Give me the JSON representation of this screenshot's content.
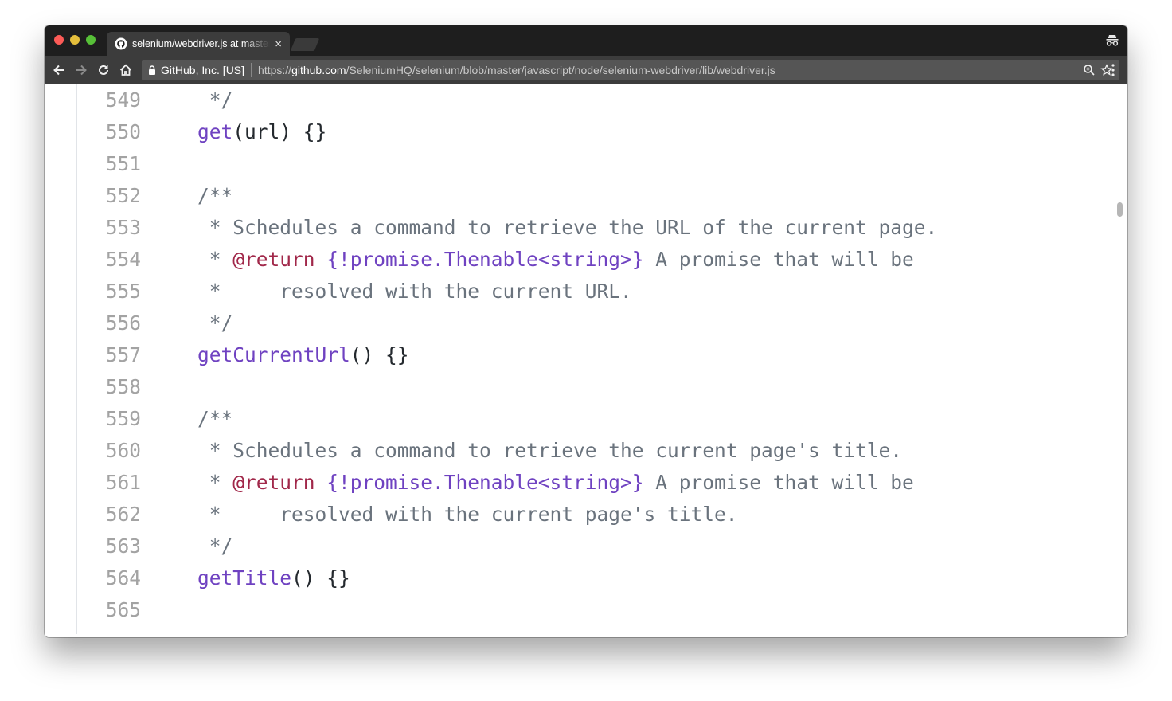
{
  "browser": {
    "tab": {
      "title": "selenium/webdriver.js at master · SeleniumHQ/selenium",
      "close_glyph": "×",
      "favicon": "github-icon"
    },
    "address_bar": {
      "identity": "GitHub, Inc. [US]",
      "url_scheme": "https://",
      "url_host": "github.com",
      "url_path": "/SeleniumHQ/selenium/blob/master/javascript/node/selenium-webdriver/lib/webdriver.js"
    },
    "icons": [
      "back-icon",
      "forward-icon",
      "reload-icon",
      "home-icon",
      "lock-icon",
      "zoom-icon",
      "star-icon",
      "menu-icon",
      "incognito-icon"
    ]
  },
  "colors": {
    "comment": "#6a737d",
    "doc_tag": "#a1284a",
    "type": "#6f42c1",
    "function": "#6f42c1",
    "line_number": "#a3a3a3",
    "plain": "#24292e"
  },
  "code_lines": [
    {
      "num": "549",
      "parts": [
        {
          "t": " */",
          "k": "cmt"
        }
      ]
    },
    {
      "num": "550",
      "parts": [
        {
          "t": "get",
          "k": "fn"
        },
        {
          "t": "(url) {}",
          "k": ""
        }
      ]
    },
    {
      "num": "551",
      "parts": []
    },
    {
      "num": "552",
      "parts": [
        {
          "t": "/**",
          "k": "cmt"
        }
      ]
    },
    {
      "num": "553",
      "parts": [
        {
          "t": " * Schedules a command to retrieve the URL of the current page.",
          "k": "cmt"
        }
      ]
    },
    {
      "num": "554",
      "parts": [
        {
          "t": " * ",
          "k": "cmt"
        },
        {
          "t": "@return",
          "k": "tag"
        },
        {
          "t": " {!promise.Thenable<string>}",
          "k": "typ"
        },
        {
          "t": " A promise that will be",
          "k": "cmt"
        }
      ]
    },
    {
      "num": "555",
      "parts": [
        {
          "t": " *     resolved with the current URL.",
          "k": "cmt"
        }
      ]
    },
    {
      "num": "556",
      "parts": [
        {
          "t": " */",
          "k": "cmt"
        }
      ]
    },
    {
      "num": "557",
      "parts": [
        {
          "t": "getCurrentUrl",
          "k": "fn"
        },
        {
          "t": "() {}",
          "k": ""
        }
      ]
    },
    {
      "num": "558",
      "parts": []
    },
    {
      "num": "559",
      "parts": [
        {
          "t": "/**",
          "k": "cmt"
        }
      ]
    },
    {
      "num": "560",
      "parts": [
        {
          "t": " * Schedules a command to retrieve the current page's title.",
          "k": "cmt"
        }
      ]
    },
    {
      "num": "561",
      "parts": [
        {
          "t": " * ",
          "k": "cmt"
        },
        {
          "t": "@return",
          "k": "tag"
        },
        {
          "t": " {!promise.Thenable<string>}",
          "k": "typ"
        },
        {
          "t": " A promise that will be",
          "k": "cmt"
        }
      ]
    },
    {
      "num": "562",
      "parts": [
        {
          "t": " *     resolved with the current page's title.",
          "k": "cmt"
        }
      ]
    },
    {
      "num": "563",
      "parts": [
        {
          "t": " */",
          "k": "cmt"
        }
      ]
    },
    {
      "num": "564",
      "parts": [
        {
          "t": "getTitle",
          "k": "fn"
        },
        {
          "t": "() {}",
          "k": ""
        }
      ]
    },
    {
      "num": "565",
      "parts": []
    }
  ]
}
